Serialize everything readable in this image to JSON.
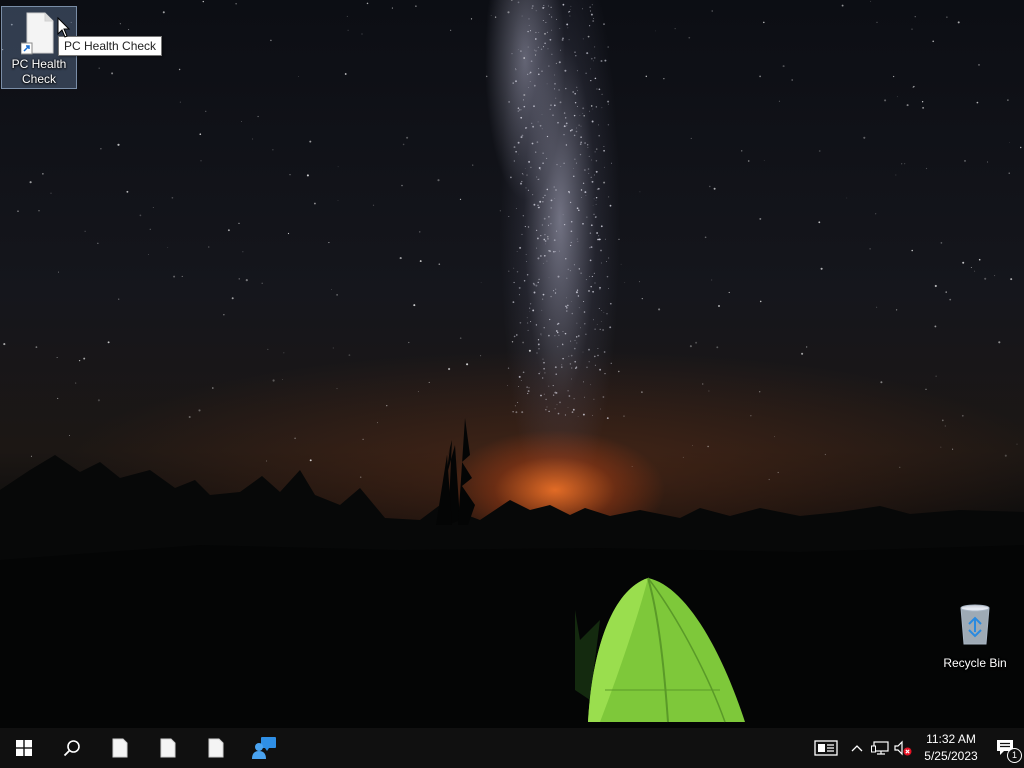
{
  "desktop": {
    "icons": [
      {
        "label": "PC Health Check",
        "icon": "document-shortcut-icon",
        "selected": true
      },
      {
        "label": "Recycle Bin",
        "icon": "recycle-bin-icon",
        "selected": false
      }
    ],
    "tooltip": "PC Health Check"
  },
  "taskbar": {
    "start": "windows-start-icon",
    "search": "search-icon",
    "apps": [
      "document-icon",
      "document-icon",
      "document-icon",
      "people-chat-icon"
    ],
    "tray": {
      "icons": [
        "news-icon",
        "chevron-up-icon",
        "network-icon",
        "volume-muted-icon"
      ],
      "time": "11:32 AM",
      "date": "5/25/2023",
      "notification_count": "1"
    }
  },
  "colors": {
    "tent": "#7ec83a",
    "glow": "#ff7a2a",
    "taskbar": "#101010"
  }
}
